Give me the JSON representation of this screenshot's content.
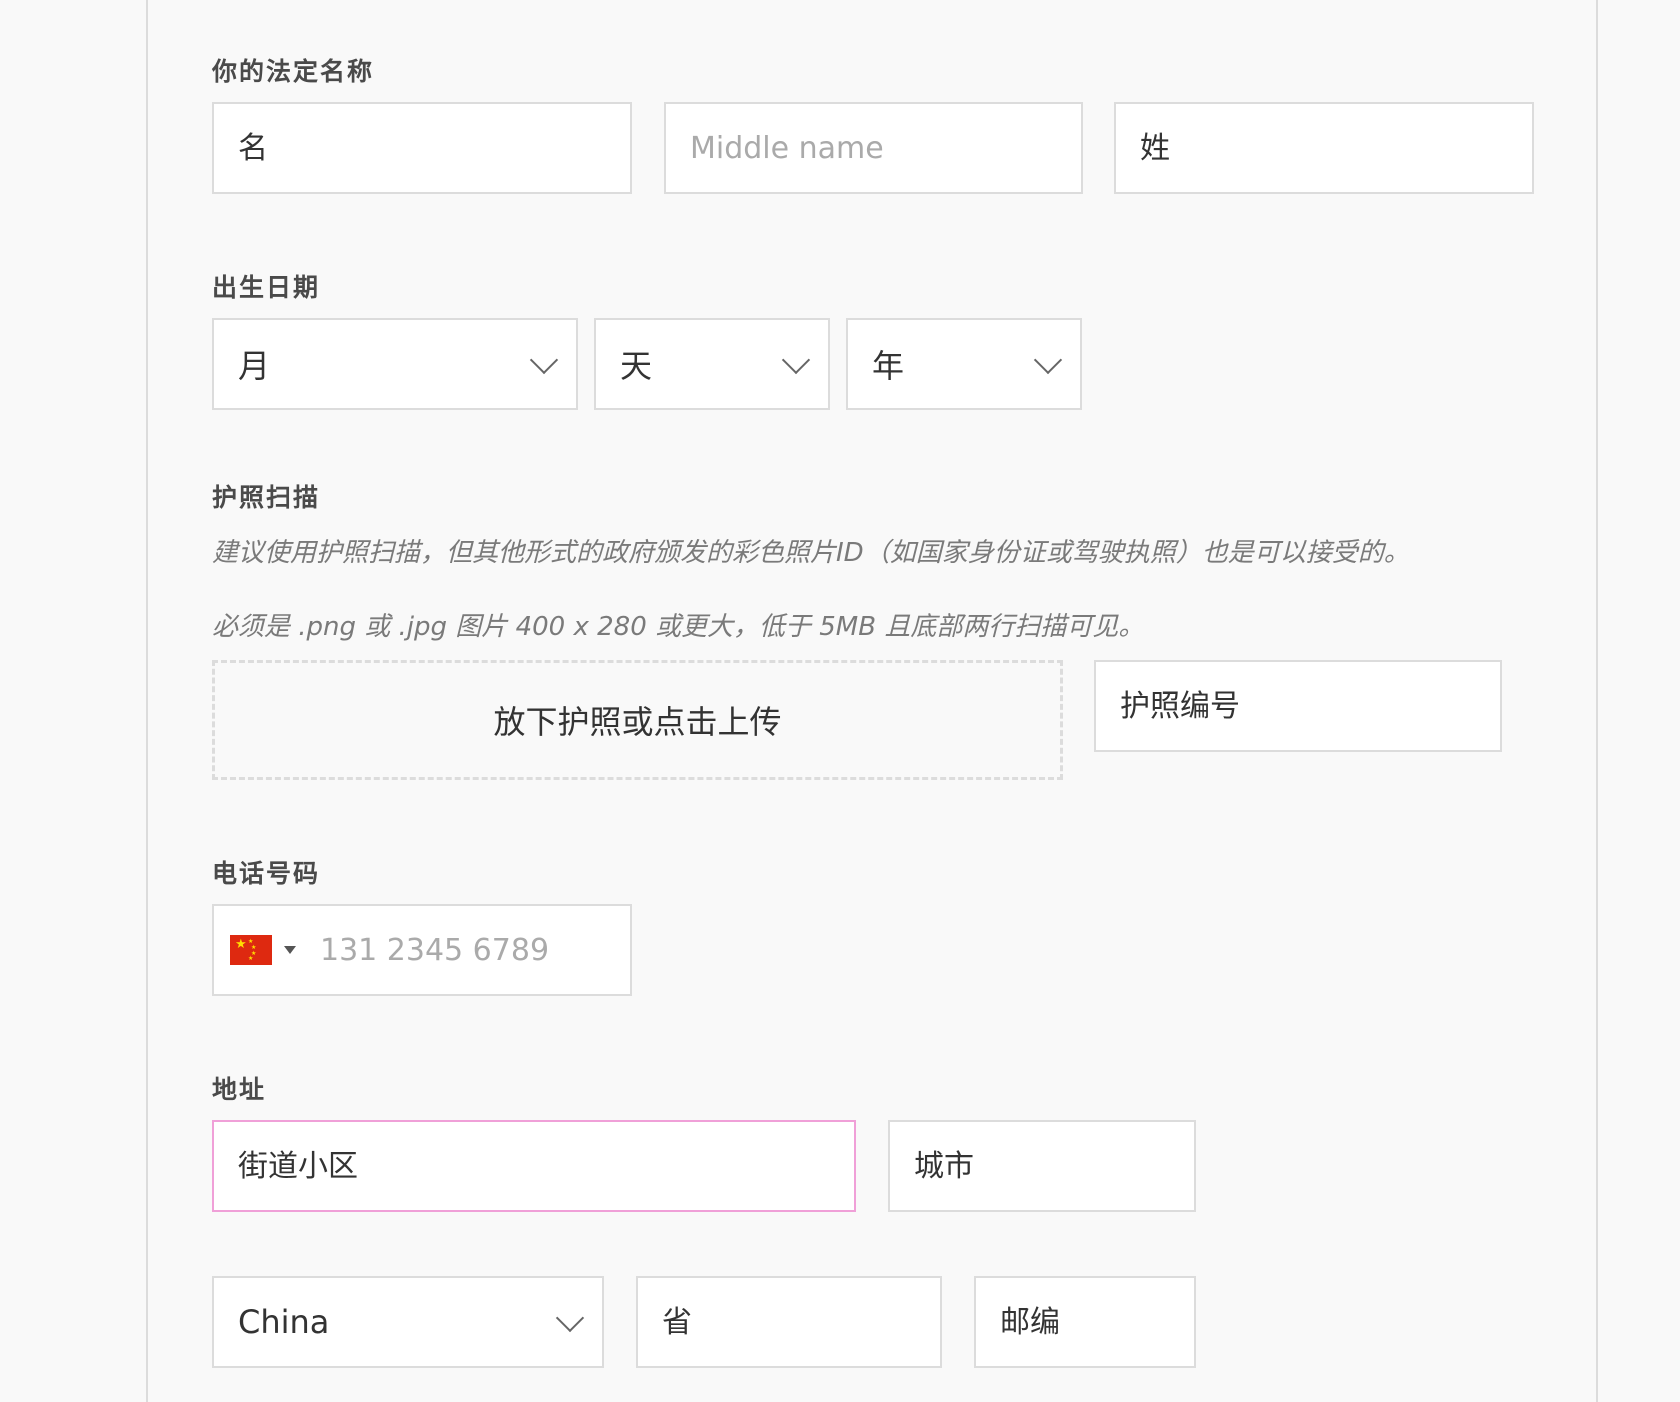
{
  "name": {
    "label": "你的法定名称",
    "first_placeholder": "名",
    "middle_placeholder": "Middle name",
    "last_placeholder": "姓"
  },
  "dob": {
    "label": "出生日期",
    "month": "月",
    "day": "天",
    "year": "年"
  },
  "passport": {
    "label": "护照扫描",
    "hint1": "建议使用护照扫描，但其他形式的政府颁发的彩色照片ID（如国家身份证或驾驶执照）也是可以接受的。",
    "hint2": "必须是 .png 或 .jpg 图片 400 x 280 或更大，低于 5MB 且底部两行扫描可见。",
    "upload_label": "放下护照或点击上传",
    "number_placeholder": "护照编号"
  },
  "phone": {
    "label": "电话号码",
    "country_flag": "cn-flag-icon",
    "placeholder": "131 2345 6789"
  },
  "address": {
    "label": "地址",
    "street_placeholder": "街道小区",
    "city_placeholder": "城市",
    "country_value": "China",
    "province_placeholder": "省",
    "postal_placeholder": "邮编"
  },
  "colors": {
    "focus_border": "#f0a0d8",
    "flag_red": "#de2910"
  }
}
